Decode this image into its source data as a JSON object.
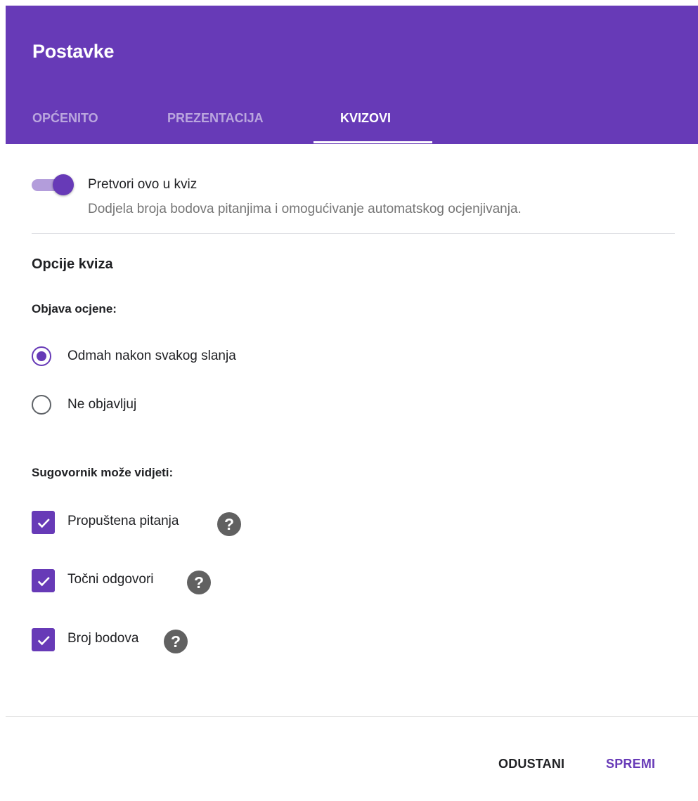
{
  "header": {
    "title": "Postavke",
    "tabs": [
      {
        "label": "OPĆENITO",
        "active": false
      },
      {
        "label": "PREZENTACIJA",
        "active": false
      },
      {
        "label": "KVIZOVI",
        "active": true
      }
    ]
  },
  "quiz_toggle": {
    "label": "Pretvori ovo u kviz",
    "description": "Dodjela broja bodova pitanjima i omogućivanje automatskog ocjenjivanja.",
    "on": true
  },
  "quiz_options": {
    "title": "Opcije kviza",
    "grade_release": {
      "label": "Objava ocjene:",
      "options": [
        {
          "label": "Odmah nakon svakog slanja",
          "checked": true
        },
        {
          "label": "Ne objavljuj",
          "checked": false
        }
      ]
    },
    "respondent_can_see": {
      "label": "Sugovornik može vidjeti:",
      "options": [
        {
          "label": "Propuštena pitanja",
          "checked": true
        },
        {
          "label": "Točni odgovori",
          "checked": true
        },
        {
          "label": "Broj bodova",
          "checked": true
        }
      ]
    }
  },
  "help_icon_glyph": "?",
  "footer": {
    "cancel_label": "ODUSTANI",
    "save_label": "SPREMI"
  },
  "colors": {
    "accent": "#673ab7",
    "accent_light": "#b39ddb",
    "help_icon": "#616161"
  }
}
